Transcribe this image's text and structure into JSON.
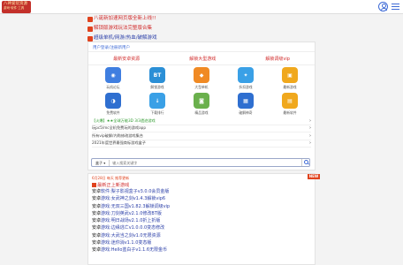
{
  "header": {
    "logo_line1": "八神爱玩资源",
    "logo_line2": "游戏·软件·工具"
  },
  "notices": [
    {
      "text": "八诞新加速网页版全新上线!!",
      "color": "red"
    },
    {
      "text": "解锁版游戏玩法完整版合集",
      "color": "red"
    },
    {
      "text": "超级单机/网游/热血/破解游戏",
      "color": "blue"
    }
  ],
  "panel": {
    "subheading": "用户登录/注册新用户",
    "tabs": [
      "最新安卓资源",
      "解锁大型游戏",
      "解锁调级vip"
    ],
    "grid": [
      {
        "label": "玩机论坛",
        "icon": "chat-icon",
        "color": "#3f7ee0",
        "glyph": "◉"
      },
      {
        "label": "解锁游戏",
        "icon": "bt-icon",
        "color": "#2b8fd6",
        "glyph": "BT"
      },
      {
        "label": "大型单机",
        "icon": "gamepad-icon",
        "color": "#f08a24",
        "glyph": "◆"
      },
      {
        "label": "折扣游戏",
        "icon": "star-icon",
        "color": "#3aa0e6",
        "glyph": "✦"
      },
      {
        "label": "最新游戏",
        "icon": "gift-icon",
        "color": "#f0a81d",
        "glyph": "▣"
      },
      {
        "label": "免费软件",
        "icon": "software-icon",
        "color": "#2f6fd0",
        "glyph": "◑"
      },
      {
        "label": "下载排行",
        "icon": "download-icon",
        "color": "#3aa0e6",
        "glyph": "↓"
      },
      {
        "label": "精品游戏",
        "icon": "android-icon",
        "color": "#6ab04c",
        "glyph": "◙"
      },
      {
        "label": "破解神奇",
        "icon": "toolbox-icon",
        "color": "#2f6fd0",
        "glyph": "▦"
      },
      {
        "label": "最新软件",
        "icon": "apps-icon",
        "color": "#f0a81d",
        "glyph": "▤"
      }
    ],
    "links": [
      {
        "text": "【火爆】★★全球万能3D 3/3遗迹游戏",
        "hot": true
      },
      {
        "text": "玩pc5/mc全机免费玩的游戏app",
        "hot": false
      },
      {
        "text": "所有vip破解/内购修改游戏集合",
        "hot": false
      },
      {
        "text": "2021年度世界最强商标游戏盒子",
        "hot": false
      }
    ],
    "search": {
      "category": "盒子 ▾",
      "placeholder": "输入搜索关键字"
    }
  },
  "latest": {
    "badge": "NEW",
    "heading": "6月28日 每天 推荐更新",
    "title": "最新正上新游戏",
    "apps": [
      {
        "kind": "安卓",
        "name": "软件:梨子影视盒子v3.0.0会员金版"
      },
      {
        "kind": "安卓",
        "name": "游戏:女武神之剑v1.4.3解锁vip6"
      },
      {
        "kind": "安卓",
        "name": "游戏:无双三国v1.82.3解锁调级vip"
      },
      {
        "kind": "安卓",
        "name": "游戏:刀剑英武v2.1.0修改BT版"
      },
      {
        "kind": "安卓",
        "name": "游戏:明日战场v2.1.0折上折版"
      },
      {
        "kind": "安卓",
        "name": "游戏:边缘逃亡v1.0.0.0变态修改"
      },
      {
        "kind": "安卓",
        "name": "游戏:大武当之剑v1.0无限资源"
      },
      {
        "kind": "安卓",
        "name": "游戏:迷你消v1.1.0变态版"
      },
      {
        "kind": "安卓",
        "name": "游戏:Hello蓝白子v1.1.6无限金币"
      }
    ]
  }
}
